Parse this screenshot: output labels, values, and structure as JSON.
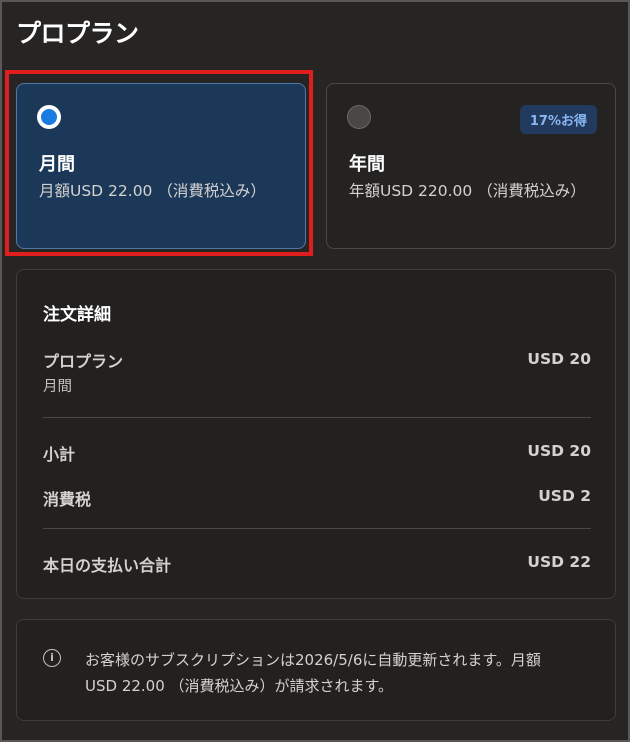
{
  "page": {
    "title": "プロプラン"
  },
  "plans": {
    "monthly": {
      "name": "月間",
      "price": "月額USD 22.00 （消費税込み）",
      "selected": true
    },
    "yearly": {
      "name": "年間",
      "price": "年額USD 220.00 （消費税込み）",
      "badge": "17%お得",
      "selected": false
    }
  },
  "order": {
    "title": "注文詳細",
    "plan_label": "プロプラン",
    "plan_period": "月間",
    "plan_amount": "USD 20",
    "subtotal_label": "小計",
    "subtotal_amount": "USD 20",
    "tax_label": "消費税",
    "tax_amount": "USD 2",
    "total_label": "本日の支払い合計",
    "total_amount": "USD 22"
  },
  "notice": {
    "icon": "info-icon",
    "icon_glyph": "i",
    "text": "お客様のサブスクリプションは2026/5/6に自動更新されます。月額USD 22.00 （消費税込み）が請求されます。"
  },
  "colors": {
    "selected_card": "#1c3858",
    "radio_on": "#1a7be0",
    "highlight": "#e01e1e",
    "badge_text": "#8ab6f0"
  }
}
